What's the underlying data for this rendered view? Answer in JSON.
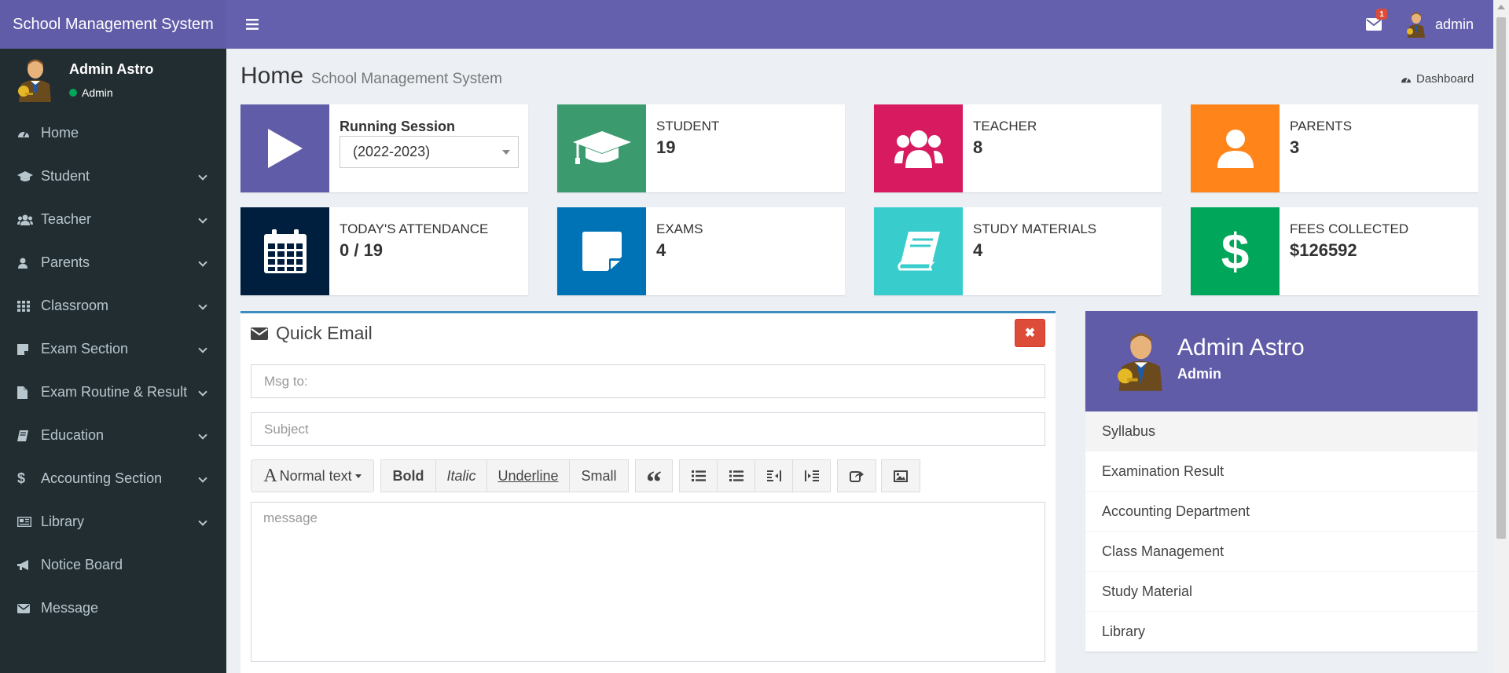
{
  "app": {
    "title": "School Management System"
  },
  "header": {
    "mail_badge": "1",
    "user_name": "admin"
  },
  "sidebar": {
    "user": {
      "name": "Admin Astro",
      "status": "Admin"
    },
    "items": [
      {
        "label": "Home",
        "icon": "dashboard-icon",
        "has_submenu": false
      },
      {
        "label": "Student",
        "icon": "graduation-cap-icon",
        "has_submenu": true
      },
      {
        "label": "Teacher",
        "icon": "users-icon",
        "has_submenu": true
      },
      {
        "label": "Parents",
        "icon": "user-icon",
        "has_submenu": true
      },
      {
        "label": "Classroom",
        "icon": "grid-icon",
        "has_submenu": true
      },
      {
        "label": "Exam Section",
        "icon": "note-icon",
        "has_submenu": true
      },
      {
        "label": "Exam Routine & Result",
        "icon": "file-icon",
        "has_submenu": true
      },
      {
        "label": "Education",
        "icon": "book-icon",
        "has_submenu": true
      },
      {
        "label": "Accounting Section",
        "icon": "dollar-icon",
        "has_submenu": true
      },
      {
        "label": "Library",
        "icon": "newspaper-icon",
        "has_submenu": true
      },
      {
        "label": "Notice Board",
        "icon": "bullhorn-icon",
        "has_submenu": false
      },
      {
        "label": "Message",
        "icon": "envelope-icon",
        "has_submenu": false
      }
    ]
  },
  "page": {
    "title": "Home",
    "subtitle": "School Management System",
    "breadcrumb": "Dashboard"
  },
  "session": {
    "title": "Running Session",
    "selected": "(2022-2023)"
  },
  "stats": [
    {
      "label": "STUDENT",
      "value": "19",
      "color": "#3c9a6f",
      "icon": "graduation-cap-icon"
    },
    {
      "label": "TEACHER",
      "value": "8",
      "color": "#d81b60",
      "icon": "users-icon"
    },
    {
      "label": "PARENTS",
      "value": "3",
      "color": "#ff851b",
      "icon": "user-icon"
    },
    {
      "label": "TODAY'S ATTENDANCE",
      "value": "0 / 19",
      "color": "#001f3f",
      "icon": "calendar-icon"
    },
    {
      "label": "EXAMS",
      "value": "4",
      "color": "#0073b7",
      "icon": "sticky-note-icon"
    },
    {
      "label": "STUDY MATERIALS",
      "value": "4",
      "color": "#39cccc",
      "icon": "book-icon"
    },
    {
      "label": "FEES COLLECTED",
      "value": "$126592",
      "color": "#00a65a",
      "icon": "dollar-icon"
    }
  ],
  "quick_email": {
    "title": "Quick Email",
    "to_placeholder": "Msg to:",
    "subject_placeholder": "Subject",
    "message_placeholder": "message",
    "toolbar": {
      "format": "Normal text",
      "bold": "Bold",
      "italic": "Italic",
      "underline": "Underline",
      "small": "Small"
    }
  },
  "profile": {
    "name": "Admin Astro",
    "role": "Admin",
    "links": [
      "Syllabus",
      "Examination Result",
      "Accounting Department",
      "Class Management",
      "Study Material",
      "Library"
    ]
  },
  "colors": {
    "header": "#605ca8",
    "sidebar": "#222d32",
    "session_box": "#605ca8",
    "close_button": "#dd4b39"
  }
}
